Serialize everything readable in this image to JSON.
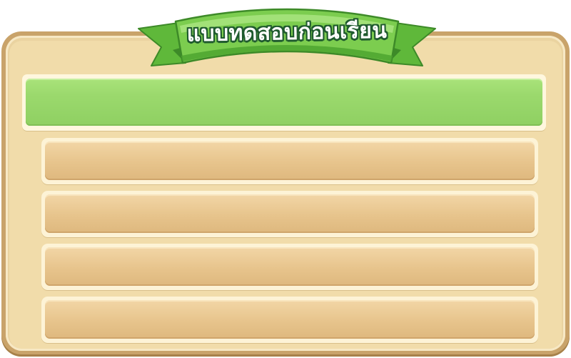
{
  "title_ribbon": {
    "title": "แบบทดสอบก่อนเรียน"
  },
  "question": {
    "text": ""
  },
  "answers": [
    {
      "text": ""
    },
    {
      "text": ""
    },
    {
      "text": ""
    },
    {
      "text": ""
    }
  ],
  "colors": {
    "board": "#f1dcaa",
    "board_border": "#c9a36a",
    "question_bar": "#9bd96d",
    "answer_bar": "#e7c48c",
    "ribbon_green": "#6cc144",
    "ribbon_outline": "#1f5a2e"
  }
}
